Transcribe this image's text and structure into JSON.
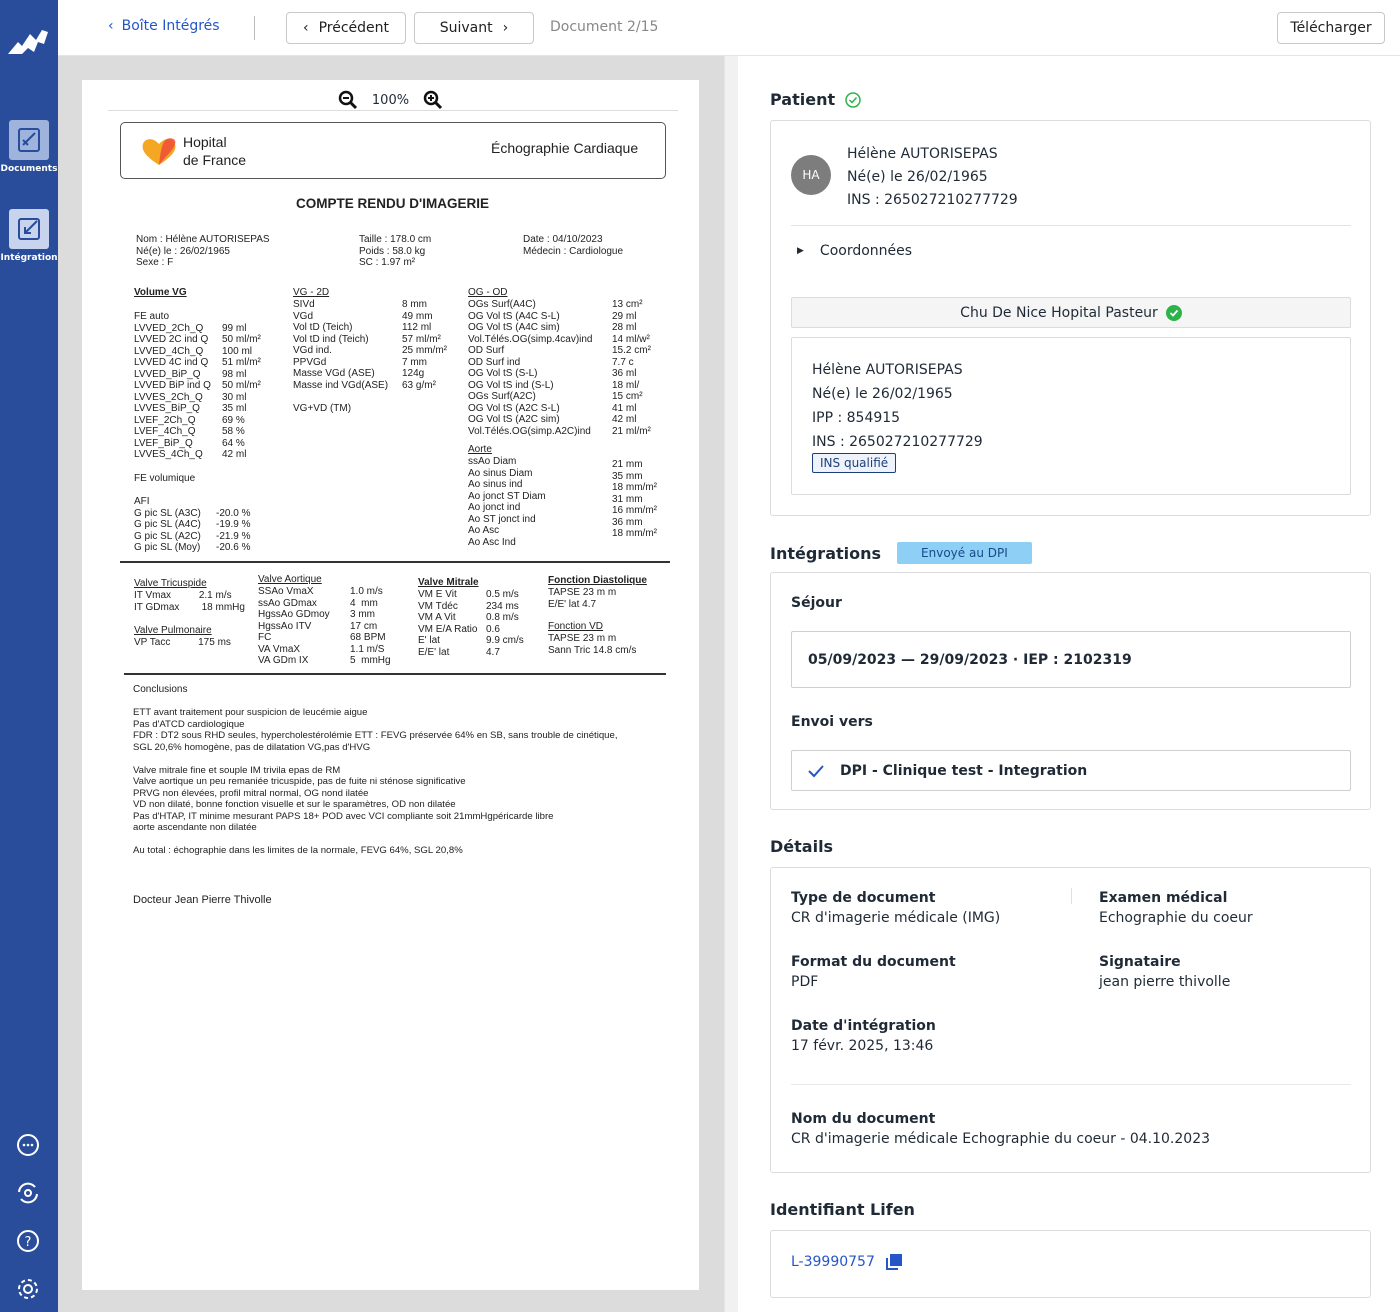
{
  "sidebar": {
    "items": [
      {
        "label": "Documents",
        "icon": "documents-icon"
      },
      {
        "label": "Intégration",
        "icon": "integration-icon"
      }
    ],
    "bottom_icons": [
      "chat-icon",
      "sync-icon",
      "help-icon",
      "settings-icon"
    ]
  },
  "topbar": {
    "back_label": "Boîte Intégrés",
    "prev_label": "Précédent",
    "next_label": "Suivant",
    "doc_index": "Document 2/15",
    "download_label": "Télécharger"
  },
  "viewer": {
    "zoom": "100%"
  },
  "document": {
    "hospital_name_1": "Hopital",
    "hospital_name_2": "de France",
    "exam_type": "Échographie Cardiaque",
    "title": "COMPTE RENDU D'IMAGERIE",
    "id_col1": "Nom : Hélène AUTORISEPAS\nNé(e) le : 26/02/1965\nSexe : F",
    "id_col2": "Taille : 178.0 cm\nPoids : 58.0 kg\nSC : 1.97 m²",
    "id_col3": "Date : 04/10/2023\nMédecin : Cardiologue",
    "vol_head": "Volume VG",
    "vol_labels": "FE auto\nLVVED_2Ch_Q\nLVVED 2C ind Q\nLVVED_4Ch_Q\nLVVED 4C ind Q\nLVVED_BiP_Q\nLVVED BiP ind Q\nLVVES_2Ch_Q\nLVVES_BiP_Q\nLVEF_2Ch_Q\nLVEF_4Ch_Q\nLVEF_BiP_Q\nLVVES_4Ch_Q",
    "vol_values": "\n99 ml\n50 ml/m²\n100 ml\n51 ml/m²\n98 ml\n50 ml/m²\n30 ml\n35 ml\n69 %\n58 %\n64 %\n42 ml",
    "fe_labels": "FE volumique\n\nAFI\nG pic SL (A3C)\nG pic SL (A4C)\nG pic SL (A2C)\nG pic SL (Moy)",
    "fe_values": "\n\n\n-20.0 %\n-19.9 %\n-21.9 %\n-20.6 %",
    "vg_head": "VG - 2D",
    "vg_labels": "SIVd\nVGd\nVol tD (Teich)\nVol tD ind (Teich)\nVGd ind.\nPPVGd\nMasse VGd (ASE)\nMasse ind VGd(ASE)\n\nVG+VD (TM)",
    "vg_values": "8 mm\n49 mm\n112 ml\n57 ml/m²\n25 mm/m²\n7 mm\n124g\n63 g/m²",
    "og_head": "OG - OD",
    "og_labels": "OGs Surf(A4C)\nOG Vol tS (A4C S-L)\nOG Vol tS (A4C sim)\nVol.Télés.OG(simp.4cav)ind\nOD Surf\nOD Surf ind\nOG Vol tS (S-L)\nOG Vol tS ind (S-L)\nOGs Surf(A2C)\nOG Vol tS (A2C S-L)\nOG Vol tS (A2C sim)\nVol.Télés.OG(simp.A2C)ind",
    "og_values": "13 cm²\n29 ml\n28 ml\n14 ml/w²\n15.2 cm²\n7.7 c\n36 ml\n18 ml/\n15 cm²\n41 ml\n42 ml\n21 ml/m²",
    "ao_head": "Aorte",
    "ao_labels": "ssAo Diam\nAo sinus Diam\nAo sinus ind\nAo jonct ST Diam\nAo jonct ind\nAo ST jonct ind\nAo Asc\nAo Asc Ind",
    "ao_values": "21 mm\n35 mm\n18 mm/m²\n31 mm\n16 mm/m²\n36 mm\n18 mm/m²",
    "tric_head": "Valve Tricuspide",
    "tric_body": "IT Vmax          2.1 m/s\nIT GDmax        18 mmHg",
    "pulm_head": "Valve Pulmonaire",
    "pulm_body": "VP Tacc          175 ms",
    "aort_head": "Valve Aortique",
    "aort_labels": "SSAo VmaX\nssAo GDmax\nHgssAo GDmoy\nHgssAo ITV\nFC\nVA VmaX\nVA GDm IX",
    "aort_values": "1.0 m/s\n4  mm\n3 mm\n17 cm\n68 BPM\n1.1 m/S\n5  mmHg",
    "mitr_head": "Valve Mitrale",
    "mitr_labels": "VM E Vit\nVM Tdéc\nVM A Vit\nVM E/A Ratio\nE' lat\nE/E' lat",
    "mitr_values": "0.5 m/s\n234 ms\n0.8 m/s\n0.6\n9.9 cm/s\n4.7",
    "diast_head": "Fonction Diastolique",
    "diast_body": "TAPSE 23 m m\nE/E' lat 4.7",
    "vd_head": "Fonction VD",
    "vd_body": "TAPSE 23 m m\nSann Tric 14.8 cm/s",
    "conclusions_head": "Conclusions",
    "conclusions_body": "ETT avant traitement pour suspicion de leucémie aigue\nPas d'ATCD cardiologique\nFDR : DT2 sous RHD seules, hypercholestérolémie ETT : FEVG préservée 64% en SB, sans trouble de cinétique,\nSGL 20,6% homogène, pas de dilatation VG,pas d'HVG\n\nValve mitrale fine et souple IM trivila epas de RM\nValve aortique un peu remaniée tricuspide, pas de fuite ni sténose significative\nPRVG non élevées, profil mitral normal, OG nond ilatée\nVD non dilaté, bonne fonction visuelle et sur le sparamètres, OD non dilatée\nPas d'HTAP, IT minime mesurant PAPS 18+ POD avec VCI compliante soit 21mmHgpéricarde libre\naorte ascendante non dilatée\n\nAu total : échographie dans les limites de la normale, FEVG 64%, SGL 20,8%",
    "signature": "Docteur Jean Pierre Thivolle"
  },
  "patient": {
    "section_title": "Patient",
    "initials": "HA",
    "name": "Hélène AUTORISEPAS",
    "birth": "Né(e) le 26/02/1965",
    "ins": "INS : 265027210277729",
    "coords_label": "Coordonnées",
    "hospital": "Chu De Nice Hopital Pasteur",
    "h_name": "Hélène AUTORISEPAS",
    "h_birth": "Né(e) le 26/02/1965",
    "h_ipp": "IPP : 854915",
    "h_ins": "INS : 265027210277729",
    "ins_badge": "INS qualifié"
  },
  "integrations": {
    "section_title": "Intégrations",
    "status_badge": "Envoyé au DPI",
    "sejour_label": "Séjour",
    "sejour_value": "05/09/2023 — 29/09/2023 · IEP : 2102319",
    "envoi_label": "Envoi vers",
    "envoi_value": "DPI - Clinique test - Integration"
  },
  "details": {
    "section_title": "Détails",
    "type_label": "Type de document",
    "type_value": "CR d'imagerie médicale (IMG)",
    "exam_label": "Examen médical",
    "exam_value": "Echographie du coeur",
    "format_label": "Format du document",
    "format_value": "PDF",
    "signer_label": "Signataire",
    "signer_value": "jean pierre thivolle",
    "date_label": "Date d'intégration",
    "date_value": "17 févr. 2025, 13:46",
    "name_label": "Nom du document",
    "name_value": "CR d'imagerie médicale Echographie du coeur - 04.10.2023"
  },
  "lifen": {
    "section_title": "Identifiant Lifen",
    "id": "L-39990757"
  },
  "colors": {
    "sidebar": "#2a4d9b",
    "accent": "#2456c7",
    "success": "#2eb34a",
    "badge": "#8ecff5"
  }
}
